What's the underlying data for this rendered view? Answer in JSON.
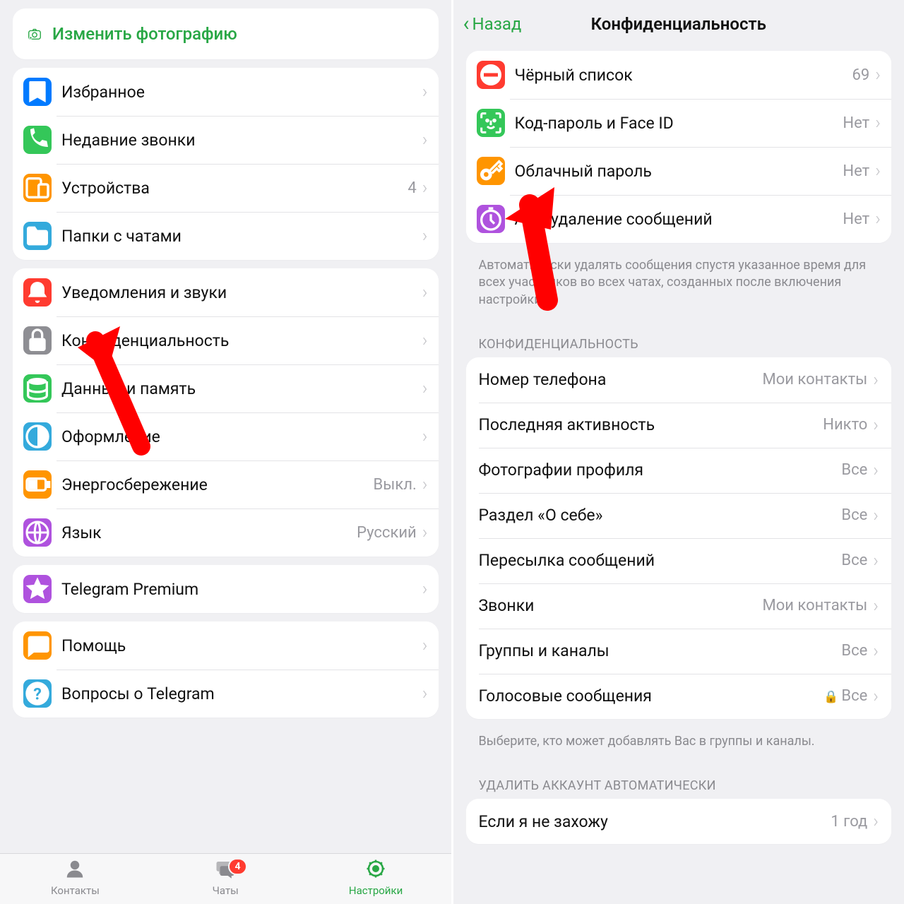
{
  "left": {
    "change_photo": "Изменить фотографию",
    "group1": [
      {
        "label": "Избранное",
        "icon": "bookmark",
        "color": "#007aff",
        "value": ""
      },
      {
        "label": "Недавние звонки",
        "icon": "phone",
        "color": "#34c759",
        "value": ""
      },
      {
        "label": "Устройства",
        "icon": "devices",
        "color": "#ff9500",
        "value": "4"
      },
      {
        "label": "Папки с чатами",
        "icon": "folder",
        "color": "#34aadc",
        "value": ""
      }
    ],
    "group2": [
      {
        "label": "Уведомления и звуки",
        "icon": "bell",
        "color": "#ff3b30",
        "value": ""
      },
      {
        "label": "Конфиденциальность",
        "icon": "lock",
        "color": "#8e8e93",
        "value": ""
      },
      {
        "label": "Данные и память",
        "icon": "data",
        "color": "#34c759",
        "value": ""
      },
      {
        "label": "Оформление",
        "icon": "theme",
        "color": "#34aadc",
        "value": ""
      },
      {
        "label": "Энергосбережение",
        "icon": "battery",
        "color": "#ff9500",
        "value": "Выкл."
      },
      {
        "label": "Язык",
        "icon": "globe",
        "color": "#af52de",
        "value": "Русский"
      }
    ],
    "group3": [
      {
        "label": "Telegram Premium",
        "icon": "star",
        "color": "#af52de",
        "value": ""
      }
    ],
    "group4": [
      {
        "label": "Помощь",
        "icon": "chat",
        "color": "#ff9500",
        "value": ""
      },
      {
        "label": "Вопросы о Telegram",
        "icon": "question",
        "color": "#34aadc",
        "value": ""
      }
    ],
    "tabs": {
      "contacts": "Контакты",
      "chats": "Чаты",
      "chats_badge": "4",
      "settings": "Настройки"
    }
  },
  "right": {
    "back": "Назад",
    "title": "Конфиденциальность",
    "group1": [
      {
        "label": "Чёрный список",
        "icon": "block",
        "color": "#ff3b30",
        "value": "69"
      },
      {
        "label": "Код-пароль и Face ID",
        "icon": "faceid",
        "color": "#34c759",
        "value": "Нет"
      },
      {
        "label": "Облачный пароль",
        "icon": "key",
        "color": "#ff9500",
        "value": "Нет"
      },
      {
        "label": "Автоудаление сообщений",
        "icon": "timer",
        "color": "#af52de",
        "value": "Нет"
      }
    ],
    "footer1": "Автоматически удалять сообщения спустя указанное время для всех участников во всех чатах, созданных после включения настройки.",
    "header2": "КОНФИДЕНЦИАЛЬНОСТЬ",
    "group2": [
      {
        "label": "Номер телефона",
        "value": "Мои контакты"
      },
      {
        "label": "Последняя активность",
        "value": "Никто"
      },
      {
        "label": "Фотографии профиля",
        "value": "Все"
      },
      {
        "label": "Раздел «О себе»",
        "value": "Все"
      },
      {
        "label": "Пересылка сообщений",
        "value": "Все"
      },
      {
        "label": "Звонки",
        "value": "Мои контакты"
      },
      {
        "label": "Группы и каналы",
        "value": "Все"
      },
      {
        "label": "Голосовые сообщения",
        "value": "Все",
        "locked": true
      }
    ],
    "footer2": "Выберите, кто может добавлять Вас в группы и каналы.",
    "header3": "УДАЛИТЬ АККАУНТ АВТОМАТИЧЕСКИ",
    "group3": [
      {
        "label": "Если я не захожу",
        "value": "1 год"
      }
    ]
  }
}
